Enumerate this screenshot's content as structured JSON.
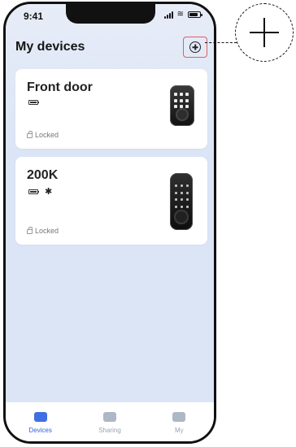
{
  "status_bar": {
    "time": "9:41"
  },
  "header": {
    "title": "My devices",
    "add_icon": "add-circle-icon"
  },
  "devices": [
    {
      "name": "Front door",
      "status": "Locked",
      "battery_icon": "battery-icon"
    },
    {
      "name": "200K",
      "status": "Locked",
      "battery_icon": "battery-icon",
      "bluetooth_icon": "bluetooth-icon"
    }
  ],
  "tabs": [
    {
      "label": "Devices",
      "icon": "devices-icon",
      "active": true
    },
    {
      "label": "Sharing",
      "icon": "sharing-icon",
      "active": false
    },
    {
      "label": "My",
      "icon": "profile-icon",
      "active": false
    }
  ],
  "callout": {
    "icon": "plus-icon"
  },
  "colors": {
    "accent": "#3f6fe3",
    "highlight": "#e05d63",
    "background": "#dbe5f6"
  }
}
